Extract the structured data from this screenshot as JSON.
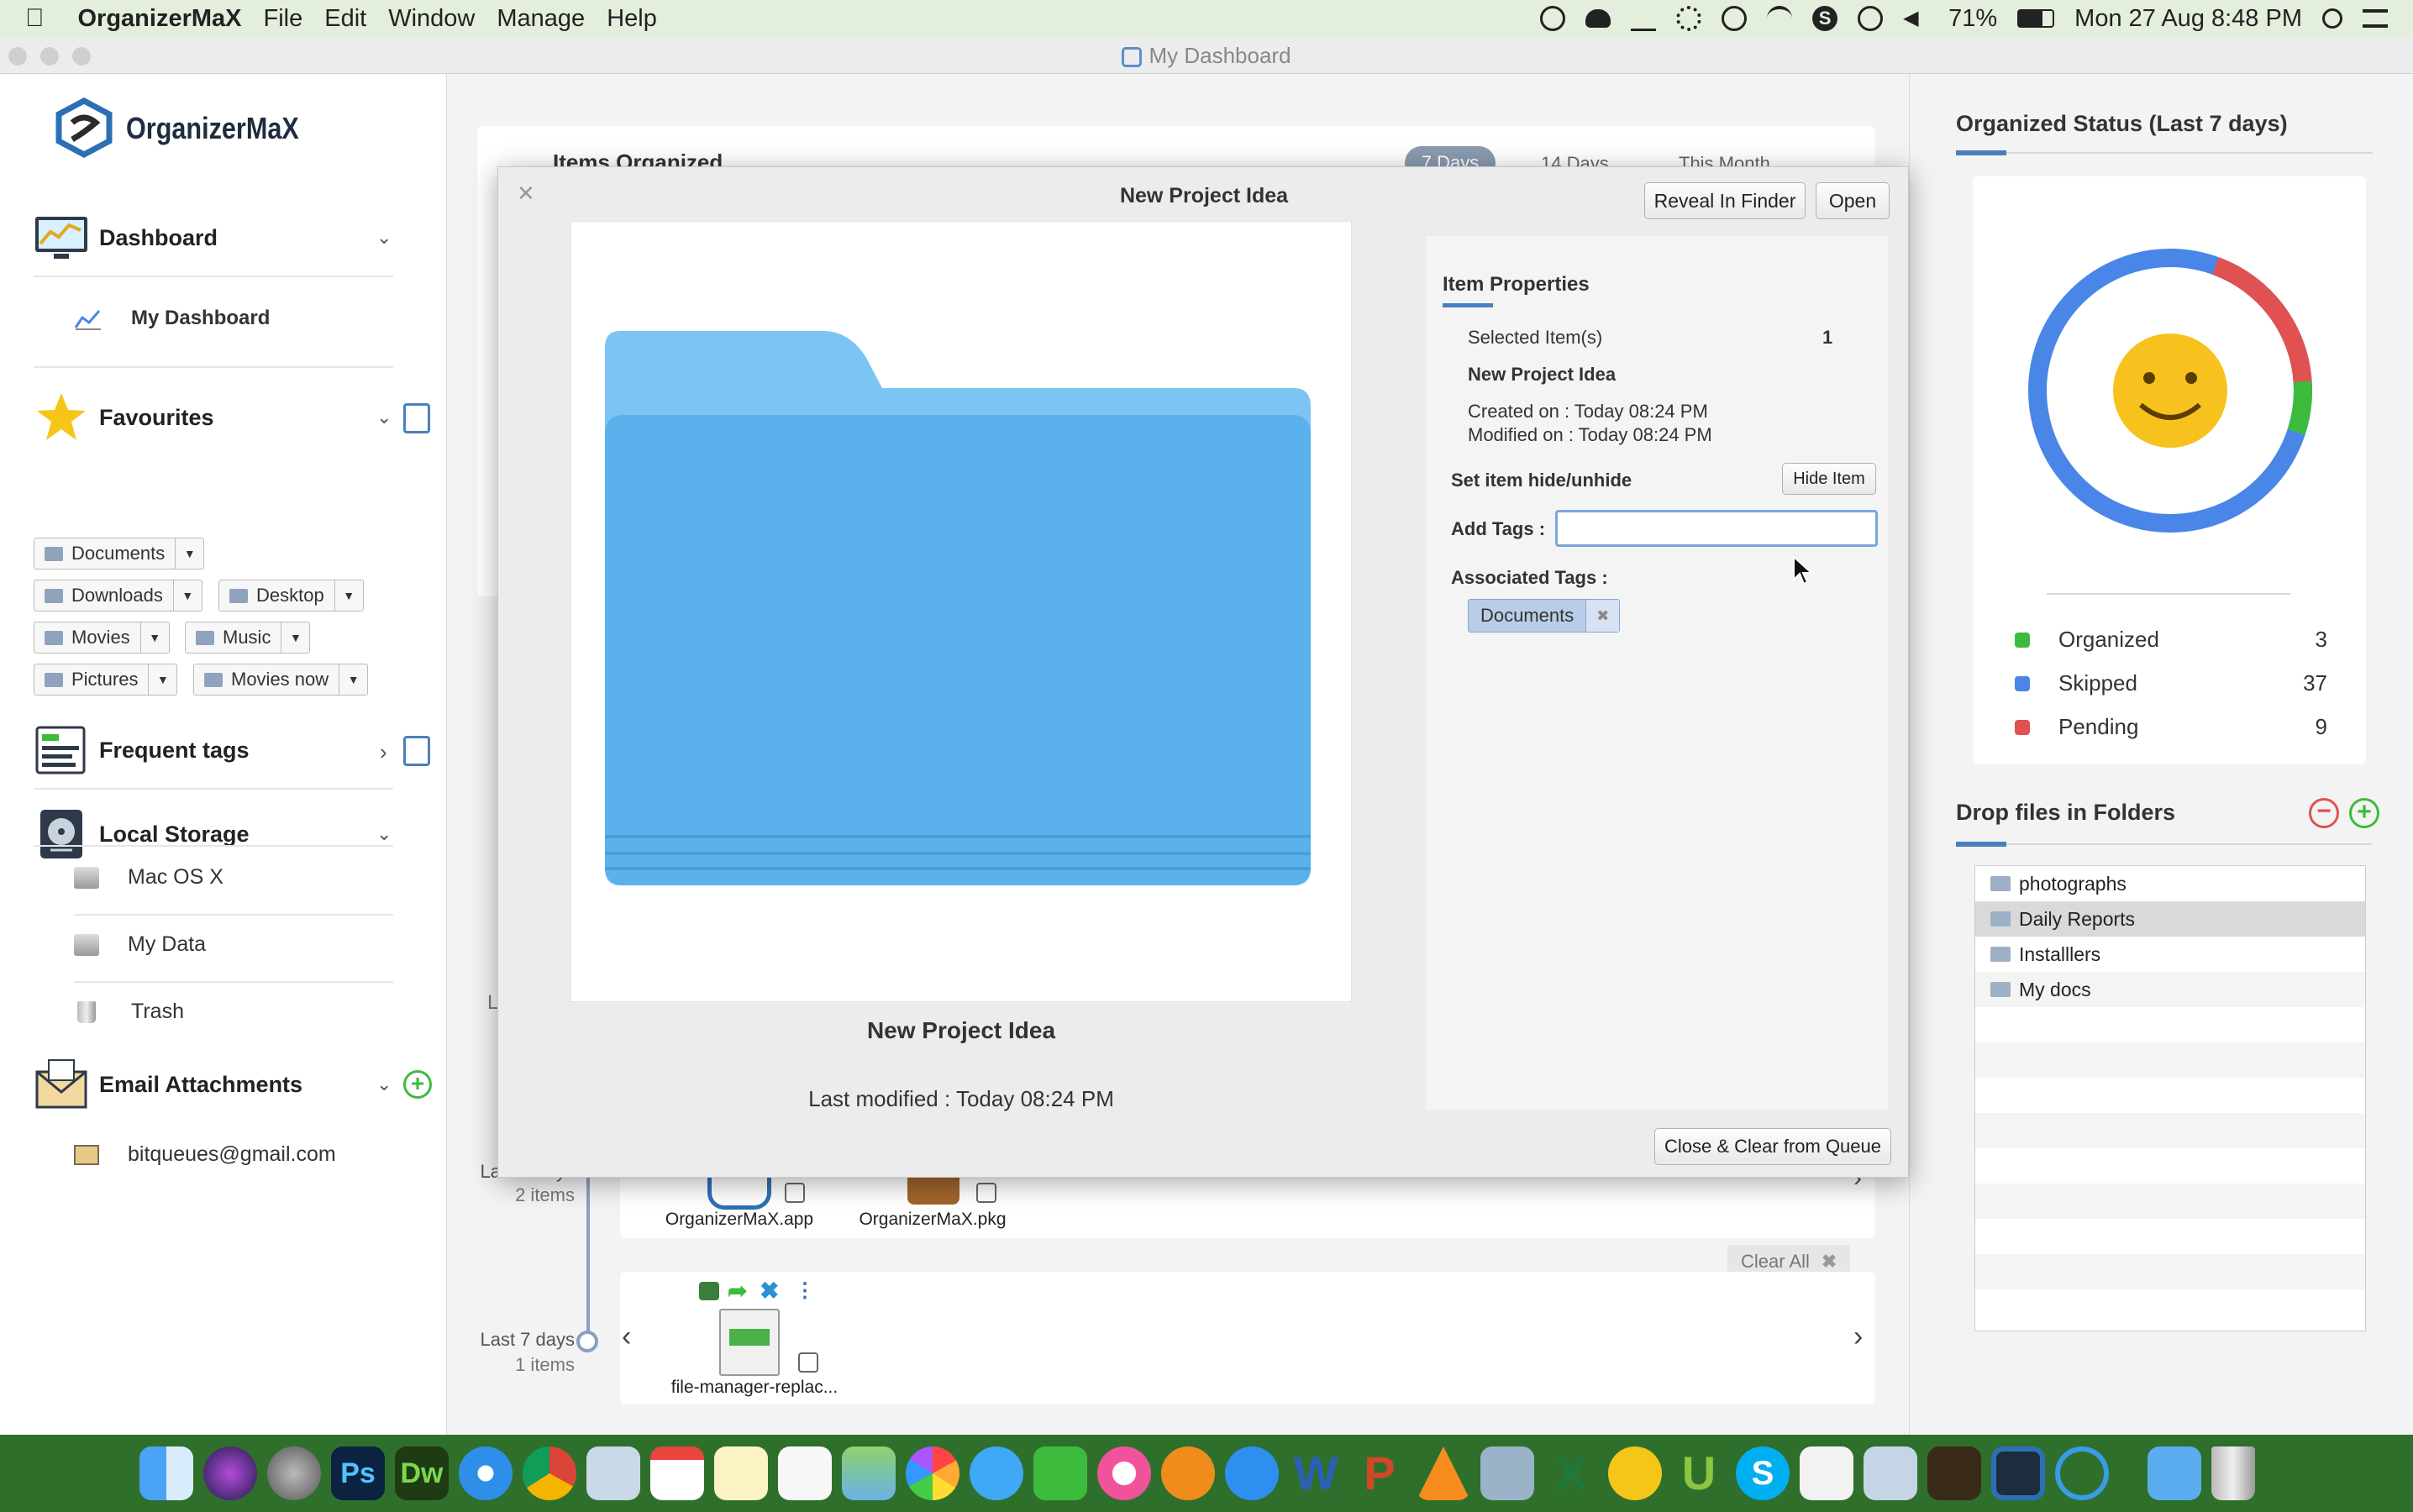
{
  "menubar": {
    "app_name": "OrganizerMaX",
    "menus": [
      "File",
      "Edit",
      "Window",
      "Manage",
      "Help"
    ],
    "battery": "71%",
    "datetime": "Mon 27 Aug  8:48 PM"
  },
  "window": {
    "title": "My Dashboard"
  },
  "sidebar": {
    "logo_text": "OrganizerMaX",
    "dashboard": {
      "label": "Dashboard",
      "items": [
        "My Dashboard"
      ]
    },
    "favourites": {
      "label": "Favourites",
      "items": [
        "Documents",
        "Downloads",
        "Desktop",
        "Movies",
        "Music",
        "Pictures",
        "Movies now"
      ]
    },
    "frequent_tags": {
      "label": "Frequent tags"
    },
    "local_storage": {
      "label": "Local Storage",
      "items": [
        "Mac OS X",
        "My Data",
        "Trash"
      ]
    },
    "email_attachments": {
      "label": "Email Attachments",
      "items": [
        "bitqueues@gmail.com"
      ]
    }
  },
  "main": {
    "items_organized_title": "Items Organized",
    "range_tabs": [
      "7 Days",
      "14 Days",
      "This Month"
    ],
    "timeline": {
      "groups": [
        {
          "label": "Last 3 days",
          "count": "2 items",
          "files": [
            "OrganizerMaX.app",
            "OrganizerMaX.pkg"
          ]
        },
        {
          "label": "Last 7 days",
          "count": "1 items",
          "files": [
            "file-manager-replac..."
          ]
        }
      ],
      "clear_all": "Clear All",
      "hidden_letter": "L"
    }
  },
  "modal": {
    "title": "New Project Idea",
    "reveal_button": "Reveal In Finder",
    "open_button": "Open",
    "preview_name": "New Project Idea",
    "last_modified": "Last modified : Today 08:24 PM",
    "properties": {
      "title": "Item Properties",
      "selected_label": "Selected Item(s)",
      "selected_count": "1",
      "item_name": "New Project Idea",
      "created": "Created on : Today 08:24 PM",
      "modified": "Modified on : Today 08:24 PM",
      "hide_label": "Set item hide/unhide",
      "hide_button": "Hide Item",
      "add_tags_label": "Add Tags :",
      "add_tags_value": "",
      "associated_label": "Associated Tags :",
      "tags": [
        "Documents"
      ]
    },
    "close_button": "Close & Clear from Queue"
  },
  "right_panel": {
    "status_title": "Organized Status (Last 7 days)",
    "legend": [
      {
        "label": "Organized",
        "value": "3",
        "color": "#3dbb3d"
      },
      {
        "label": "Skipped",
        "value": "37",
        "color": "#4a86e8"
      },
      {
        "label": "Pending",
        "value": "9",
        "color": "#e05252"
      }
    ],
    "drop_title": "Drop files in Folders",
    "folders": [
      "photographs",
      "Daily Reports",
      "Installlers",
      "My docs"
    ],
    "selected_folder": "Daily Reports"
  },
  "colors": {
    "accent": "#4a7fbf",
    "dock": "#2f6f2c",
    "menubar": "#e4eedc"
  }
}
